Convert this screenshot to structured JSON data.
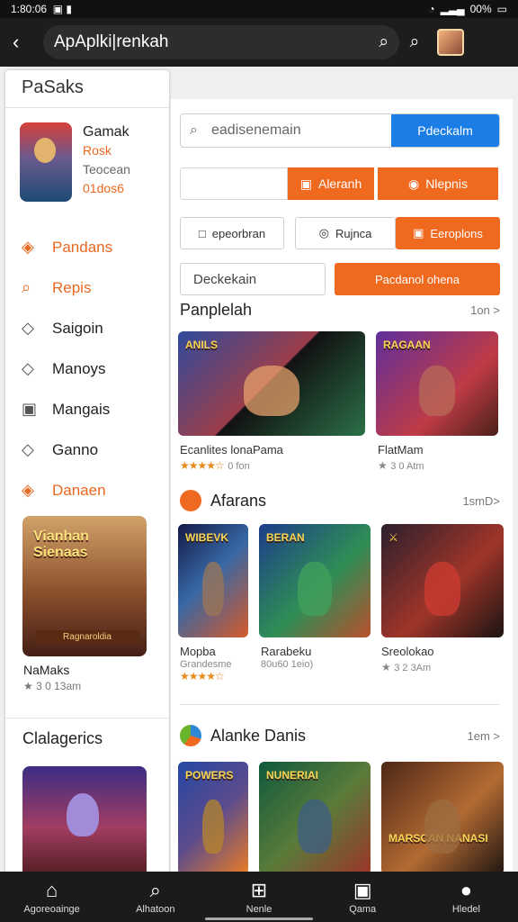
{
  "status": {
    "time": "1:80:06",
    "battery": "00%"
  },
  "header": {
    "search": "ApAplki|renkah"
  },
  "sidebar": {
    "title": "PaSaks",
    "profile": {
      "name": "Gamak",
      "line1": "Rosk",
      "line2": "Teocean",
      "line3": "01dos6"
    },
    "items": [
      {
        "label": "Pandans",
        "icon": "tag-icon",
        "accent": true
      },
      {
        "label": "Repis",
        "icon": "search-icon",
        "accent": true
      },
      {
        "label": "Saigoin",
        "icon": "tag-icon"
      },
      {
        "label": "Manoys",
        "icon": "tag-icon"
      },
      {
        "label": "Mangais",
        "icon": "camera-icon"
      },
      {
        "label": "Ganno",
        "icon": "tag-icon"
      },
      {
        "label": "Danaen",
        "icon": "tag-icon",
        "accent": true
      }
    ],
    "featured": {
      "title": "Vianhan Sienaas",
      "subtitle": "Ragnaroldia",
      "name": "NaMaks",
      "meta": "3 0 13am"
    },
    "categories_label": "Clalagerics"
  },
  "main": {
    "search_placeholder": "eadisenemain",
    "search_button": "Pdeckalm",
    "action_buttons": [
      "Aleranh",
      "Nlepnis"
    ],
    "filters": [
      "epeorbran",
      "Rujnca",
      "Eeroplons"
    ],
    "select_value": "Deckekain",
    "select_button": "Pacdanol ohena",
    "section1": {
      "title": "Panplelah",
      "more": "1on >"
    },
    "section1_games": [
      {
        "name": "Ecanlites lonaPama",
        "meta": "0 fon",
        "stars": "★★★★☆"
      },
      {
        "name": "FlatMam",
        "meta": "3 0 Atm",
        "stars": "★"
      }
    ],
    "section2": {
      "title": "Afarans",
      "more": "1smD>"
    },
    "section2_games": [
      {
        "name": "Mopba",
        "line2": "Grandesme",
        "stars": "★★★★☆"
      },
      {
        "name": "Rarabeku",
        "line2": "80u60 1eio)"
      },
      {
        "name": "Sreolokao",
        "line2": "3 2 3Am",
        "stars": "★"
      }
    ],
    "section3": {
      "title": "Alanke Danis",
      "more": "1em >"
    }
  },
  "nav": [
    {
      "label": "Agoreoainge",
      "icon": "home-icon"
    },
    {
      "label": "Alhatoon",
      "icon": "search-icon"
    },
    {
      "label": "Nenle",
      "icon": "plus-icon"
    },
    {
      "label": "Qama",
      "icon": "calendar-icon"
    },
    {
      "label": "Hledel",
      "icon": "user-icon"
    }
  ]
}
